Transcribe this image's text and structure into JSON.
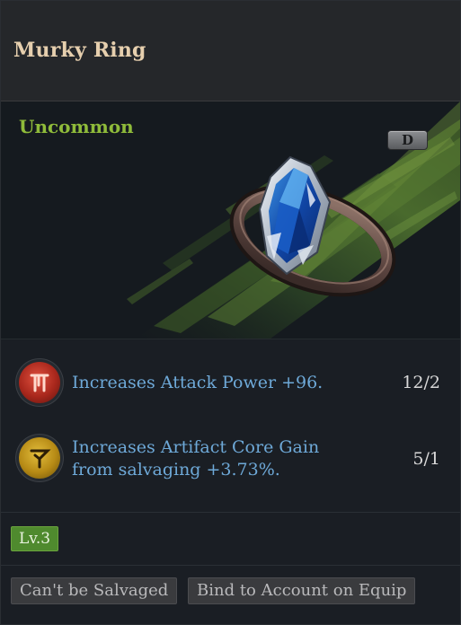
{
  "item": {
    "name": "Murky Ring",
    "rarity": "Uncommon",
    "grade": "D",
    "rarity_color": "#8fbb3a",
    "image": "ring-with-blue-gem-icon"
  },
  "stats": [
    {
      "icon": "attack-power-icon",
      "color": "#c23a2a",
      "text": "Increases Attack Power +96.",
      "count": "12/2"
    },
    {
      "icon": "artifact-core-icon",
      "color": "#c79a1f",
      "text": "Increases Artifact Core Gain\nfrom salvaging +3.73%.",
      "count": "5/1"
    }
  ],
  "level": {
    "label": "Lv.3"
  },
  "tags": [
    {
      "label": "Can't be Salvaged"
    },
    {
      "label": "Bind to Account on Equip"
    }
  ]
}
